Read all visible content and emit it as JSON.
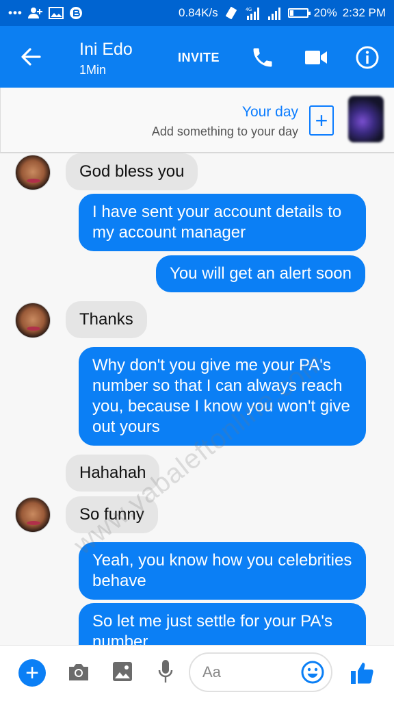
{
  "status_bar": {
    "dots": "•••",
    "speed": "0.84K/s",
    "network": "4G",
    "battery": "20%",
    "battery_level": 0.2,
    "time": "2:32 PM"
  },
  "header": {
    "contact_name": "Ini Edo",
    "contact_status": "1Min",
    "invite_label": "INVITE",
    "icons": [
      "back-arrow-icon",
      "phone-icon",
      "video-camera-icon",
      "info-icon"
    ]
  },
  "your_day": {
    "title": "Your day",
    "subtitle": "Add something to your day",
    "add_label": "+"
  },
  "messages": [
    {
      "dir": "in",
      "text": "God bless you"
    },
    {
      "dir": "out",
      "text": "I have sent your account details to my account manager"
    },
    {
      "dir": "out",
      "text": "You will get an alert soon"
    },
    {
      "dir": "in",
      "text": "Thanks"
    },
    {
      "dir": "out",
      "text": "Why don't you give me your PA's number so that I can always reach you, because I know you won't give out yours"
    },
    {
      "dir": "in",
      "text": "Hahahah"
    },
    {
      "dir": "in",
      "text": "So funny"
    },
    {
      "dir": "out",
      "text": "Yeah, you know how you celebrities behave"
    },
    {
      "dir": "out",
      "text": "So let me just settle for your PA's number"
    }
  ],
  "watermark": "www.yabaleftonline.com",
  "composer": {
    "plus_label": "+",
    "placeholder": "Aa",
    "icons": [
      "plus-icon",
      "camera-icon",
      "image-icon",
      "microphone-icon",
      "emoji-icon",
      "thumbs-up-icon"
    ]
  },
  "colors": {
    "status_bar": "#0064d1",
    "header": "#0c7ff2",
    "outgoing_bubble": "#0b7ff5",
    "incoming_bubble": "#e5e5e5",
    "accent": "#0a7cff"
  }
}
